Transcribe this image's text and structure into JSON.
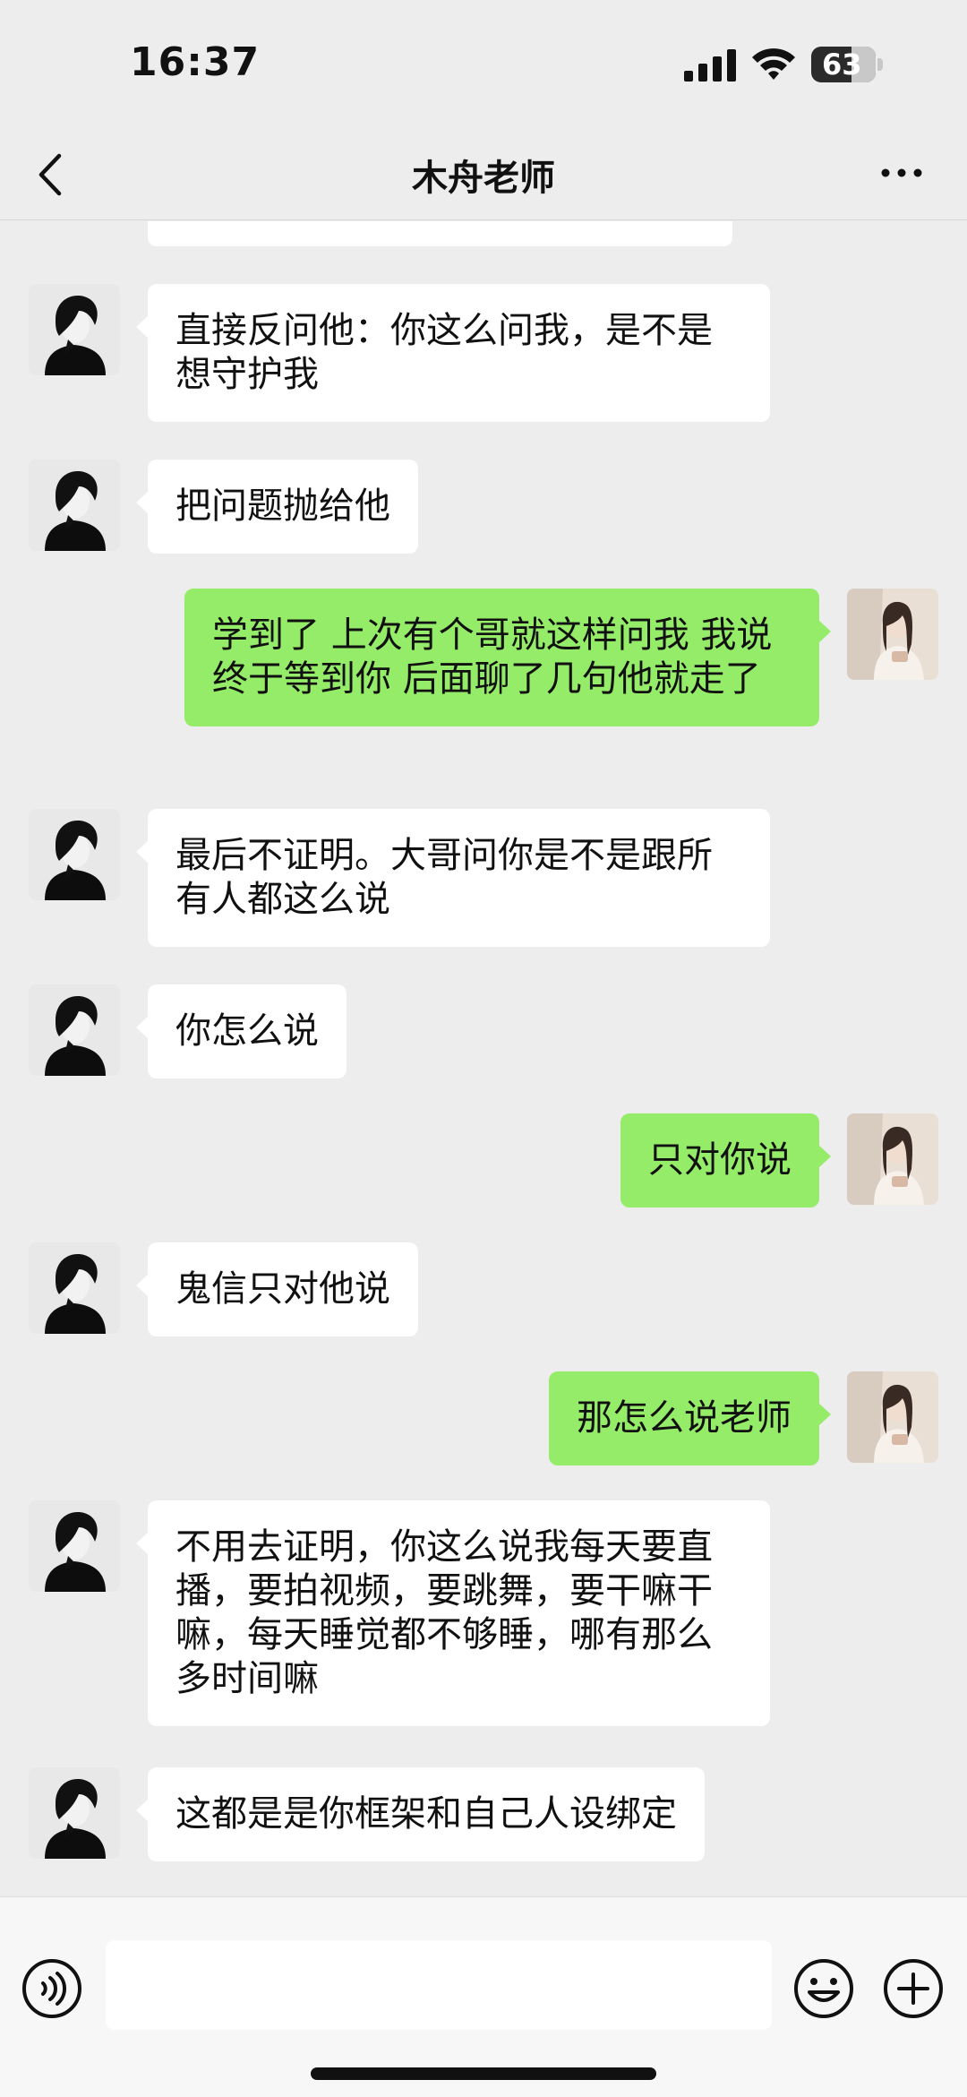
{
  "status_bar": {
    "time": "16:37",
    "battery": "63",
    "battery_level_percent": 63
  },
  "header": {
    "title": "木舟老师"
  },
  "messages": [
    {
      "side": "left",
      "text": "直接反问他：你这么问我，是不是想守护我"
    },
    {
      "side": "left",
      "text": "把问题抛给他"
    },
    {
      "side": "right",
      "text": "学到了 上次有个哥就这样问我 我说终于等到你 后面聊了几句他就走了"
    },
    {
      "side": "left",
      "text": "最后不证明。大哥问你是不是跟所有人都这么说"
    },
    {
      "side": "left",
      "text": "你怎么说"
    },
    {
      "side": "right",
      "text": "只对你说"
    },
    {
      "side": "left",
      "text": "鬼信只对他说"
    },
    {
      "side": "right",
      "text": "那怎么说老师"
    },
    {
      "side": "left",
      "text": "不用去证明，你这么说我每天要直播，要拍视频，要跳舞，要干嘛干嘛，每天睡觉都不够睡，哪有那么多时间嘛"
    },
    {
      "side": "left",
      "text": "这都是是你框架和自己人设绑定"
    }
  ],
  "input_bar": {
    "placeholder": ""
  },
  "icons": {
    "back": "chevron-left-icon",
    "more": "more-dots-icon",
    "voice": "voice-icon",
    "emoji": "emoji-icon",
    "add": "plus-icon"
  },
  "colors": {
    "self_bubble": "#95ec69",
    "other_bubble": "#ffffff",
    "background": "#ededed"
  }
}
